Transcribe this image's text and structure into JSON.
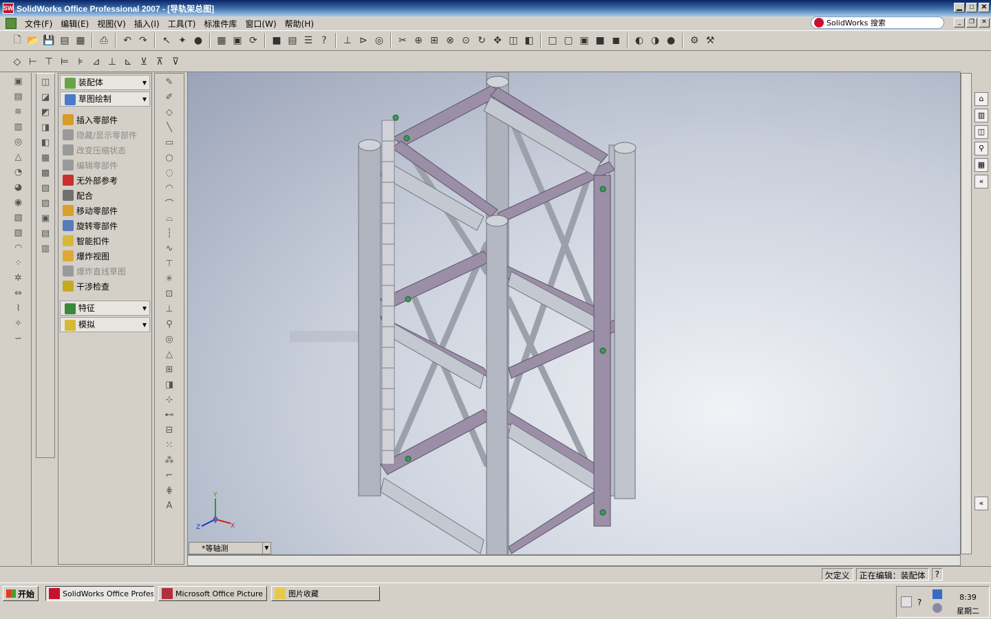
{
  "window": {
    "title": "SolidWorks Office Professional 2007 - [导轨架总图]",
    "app_icon_label": "SW",
    "btn_min": "▁",
    "btn_max": "□",
    "btn_close": "✕"
  },
  "menu": {
    "items": [
      "文件(F)",
      "编辑(E)",
      "视图(V)",
      "插入(I)",
      "工具(T)",
      "标准件库",
      "窗口(W)",
      "帮助(H)"
    ]
  },
  "search": {
    "placeholder": "SolidWorks 搜索"
  },
  "command_manager": {
    "header_assembly": "装配体",
    "header_sketch": "草图绘制",
    "items": [
      {
        "label": "插入零部件",
        "enabled": true
      },
      {
        "label": "隐藏/显示零部件",
        "enabled": false
      },
      {
        "label": "改变压缩状态",
        "enabled": false
      },
      {
        "label": "编辑零部件",
        "enabled": false
      },
      {
        "label": "无外部参考",
        "enabled": true
      },
      {
        "label": "配合",
        "enabled": true
      },
      {
        "label": "移动零部件",
        "enabled": true
      },
      {
        "label": "旋转零部件",
        "enabled": true
      },
      {
        "label": "智能扣件",
        "enabled": true
      },
      {
        "label": "爆炸视图",
        "enabled": true
      },
      {
        "label": "爆炸直线草图",
        "enabled": false
      },
      {
        "label": "干涉检查",
        "enabled": true
      }
    ],
    "header_features": "特征",
    "header_simulation": "模拟"
  },
  "viewport": {
    "view_name": "*等轴测",
    "triad": {
      "x": "X",
      "y": "Y",
      "z": "Z"
    }
  },
  "status": {
    "definition": "欠定义",
    "editing": "正在编辑：装配体",
    "help_icon": "?"
  },
  "taskbar": {
    "start_label": "开始",
    "tasks": [
      {
        "label": "SolidWorks Office Profes...",
        "active": true
      },
      {
        "label": "Microsoft Office Picture ...",
        "active": false
      },
      {
        "label": "图片收藏",
        "active": false
      }
    ],
    "clock_time": "8:39",
    "clock_day": "星期二"
  },
  "colors": {
    "frame_purple": "#9b8fa8",
    "frame_gray": "#c4c8d0",
    "title_blue": "#0a246a"
  }
}
